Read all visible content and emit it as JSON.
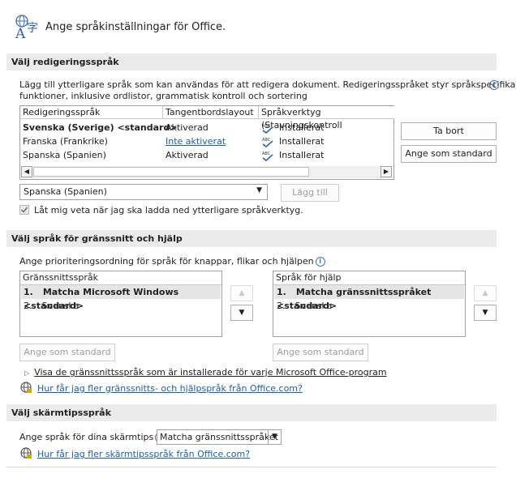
{
  "header": {
    "title": "Ange språkinställningar för Office.",
    "icon": "language-icon"
  },
  "editing": {
    "section_title": "Välj redigeringsspråk",
    "description_line1": "Lägg till ytterligare språk som kan användas för att redigera dokument. Redigeringsspråket styr språkspecifika",
    "description_line2": "funktioner, inklusive ordlistor, grammatisk kontroll och sortering",
    "columns": [
      "Redigeringsspråk",
      "Tangentbordslayout",
      "Språkverktyg (Stavningskontroll"
    ],
    "rows": [
      {
        "language": "Svenska (Sverige) <standard>",
        "keyboard": "Aktiverad",
        "proofing": "Installerat",
        "bold": true
      },
      {
        "language": "Franska (Frankrike)",
        "keyboard": "Inte aktiverat",
        "proofing": "Installerat",
        "link": true
      },
      {
        "language": "Spanska (Spanien)",
        "keyboard": "Aktiverad",
        "proofing": "Installerat"
      }
    ],
    "remove_button": "Ta bort",
    "set_default_button": "Ange som standard",
    "dropdown_value": "Spanska (Spanien)",
    "add_button": "Lägg till",
    "checkbox_label": "Låt mig veta när jag ska ladda ned ytterligare språkverktyg.",
    "checkbox_checked": true
  },
  "ui_help": {
    "section_title": "Välj språk för gränssnitt och hjälp",
    "description": "Ange prioriteringsordning för språk för knappar, flikar och hjälpen",
    "ui_list": {
      "header": "Gränssnittsspråk",
      "items": [
        {
          "num": "1.",
          "label": "Matcha Microsoft Windows <standard>",
          "bold": true
        },
        {
          "num": "2.",
          "label": "Svenska"
        }
      ]
    },
    "help_list": {
      "header": "Språk för hjälp",
      "items": [
        {
          "num": "1.",
          "label": "Matcha gränssnittsspråket <standard>",
          "bold": true
        },
        {
          "num": "2.",
          "label": "Svenska"
        }
      ]
    },
    "set_default_left": "Ange som standard",
    "set_default_right": "Ange som standard",
    "show_languages": "Visa de gränssnittsspråk som är installerade för varje Microsoft Office-program",
    "more_link": "Hur får jag fler gränssnitts- och hjälpspråk från Office.com?"
  },
  "screentip": {
    "section_title": "Välj skärmtipsspråk",
    "label": "Ange språk för dina skärmtips",
    "dropdown_value": "Matcha gränssnittsspråket",
    "more_link": "Hur får jag fler skärmtipsspråk från Office.com?"
  },
  "colors": {
    "accent": "#1a5fb4",
    "section_bg": "#ebebeb",
    "selected_row": "#e5e5e5"
  }
}
